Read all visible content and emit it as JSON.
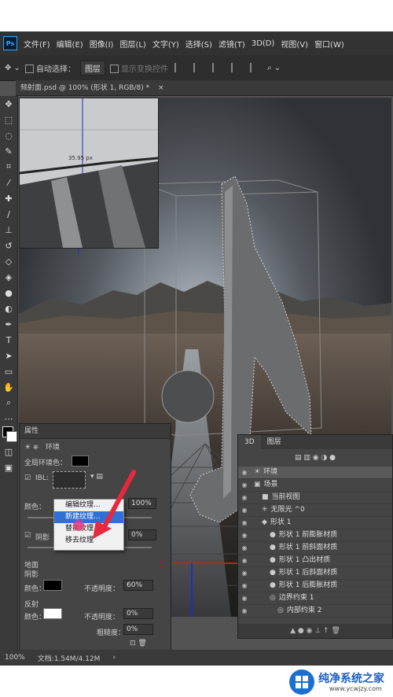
{
  "menu": {
    "logo": "Ps",
    "items": [
      "文件(F)",
      "编辑(E)",
      "图像(I)",
      "图层(L)",
      "文字(Y)",
      "选择(S)",
      "滤镜(T)",
      "3D(D)",
      "视图(V)",
      "窗口(W)"
    ]
  },
  "options": {
    "auto_select": "自动选择：",
    "layer_mode": "图层",
    "show_transform": "显示变换控件"
  },
  "doc_tab": {
    "title": "频射面.psd @ 100% (形状 1, RGB/8) *",
    "close": "×"
  },
  "navigator": {
    "measure": "35.95 px"
  },
  "properties": {
    "title": "属性",
    "section": "环境",
    "global_ambient_label": "全局环境色：",
    "ibl_label": "IBL:",
    "color_label": "颜色：",
    "intensity_value": "100%",
    "shadow_label": "阴影",
    "softness_value": "0%",
    "ground_label": "地面",
    "ground_shadow_label": "阴影",
    "ground_color_label": "颜色：",
    "opacity_label": "不透明度：",
    "ground_opacity": "60%",
    "reflection_label": "反射",
    "reflection_color_label": "颜色：",
    "reflection_opacity_label": "不透明度：",
    "reflection_opacity": "0%",
    "roughness_label": "粗糙度：",
    "roughness": "0%"
  },
  "context_menu": {
    "items": [
      "编辑纹理...",
      "新建纹理...",
      "替换纹理...",
      "移去纹理"
    ],
    "highlight_index": 1
  },
  "panel3d": {
    "tabs": [
      "3D",
      "图层"
    ],
    "rows": [
      {
        "label": "环境",
        "indent": 0,
        "icon": "☀"
      },
      {
        "label": "场景",
        "indent": 0,
        "icon": "▣"
      },
      {
        "label": "当前视图",
        "indent": 1,
        "icon": "■"
      },
      {
        "label": "无限光 ^0",
        "indent": 1,
        "icon": "✳"
      },
      {
        "label": "形状 1",
        "indent": 1,
        "icon": "◆"
      },
      {
        "label": "形状 1 前膨胀材质",
        "indent": 2,
        "icon": "●"
      },
      {
        "label": "形状 1 前斜面材质",
        "indent": 2,
        "icon": "●"
      },
      {
        "label": "形状 1 凸出材质",
        "indent": 2,
        "icon": "●"
      },
      {
        "label": "形状 1 后斜面材质",
        "indent": 2,
        "icon": "●"
      },
      {
        "label": "形状 1 后膨胀材质",
        "indent": 2,
        "icon": "●"
      },
      {
        "label": "边界约束 1",
        "indent": 2,
        "icon": "◎"
      },
      {
        "label": "内部约束 2",
        "indent": 3,
        "icon": "◎"
      }
    ]
  },
  "status": {
    "zoom": "100%",
    "doc": "文档:1.54M/4.12M"
  },
  "watermark": {
    "brand": "纯净系统之家",
    "url": "www.ycwjzy.com"
  }
}
